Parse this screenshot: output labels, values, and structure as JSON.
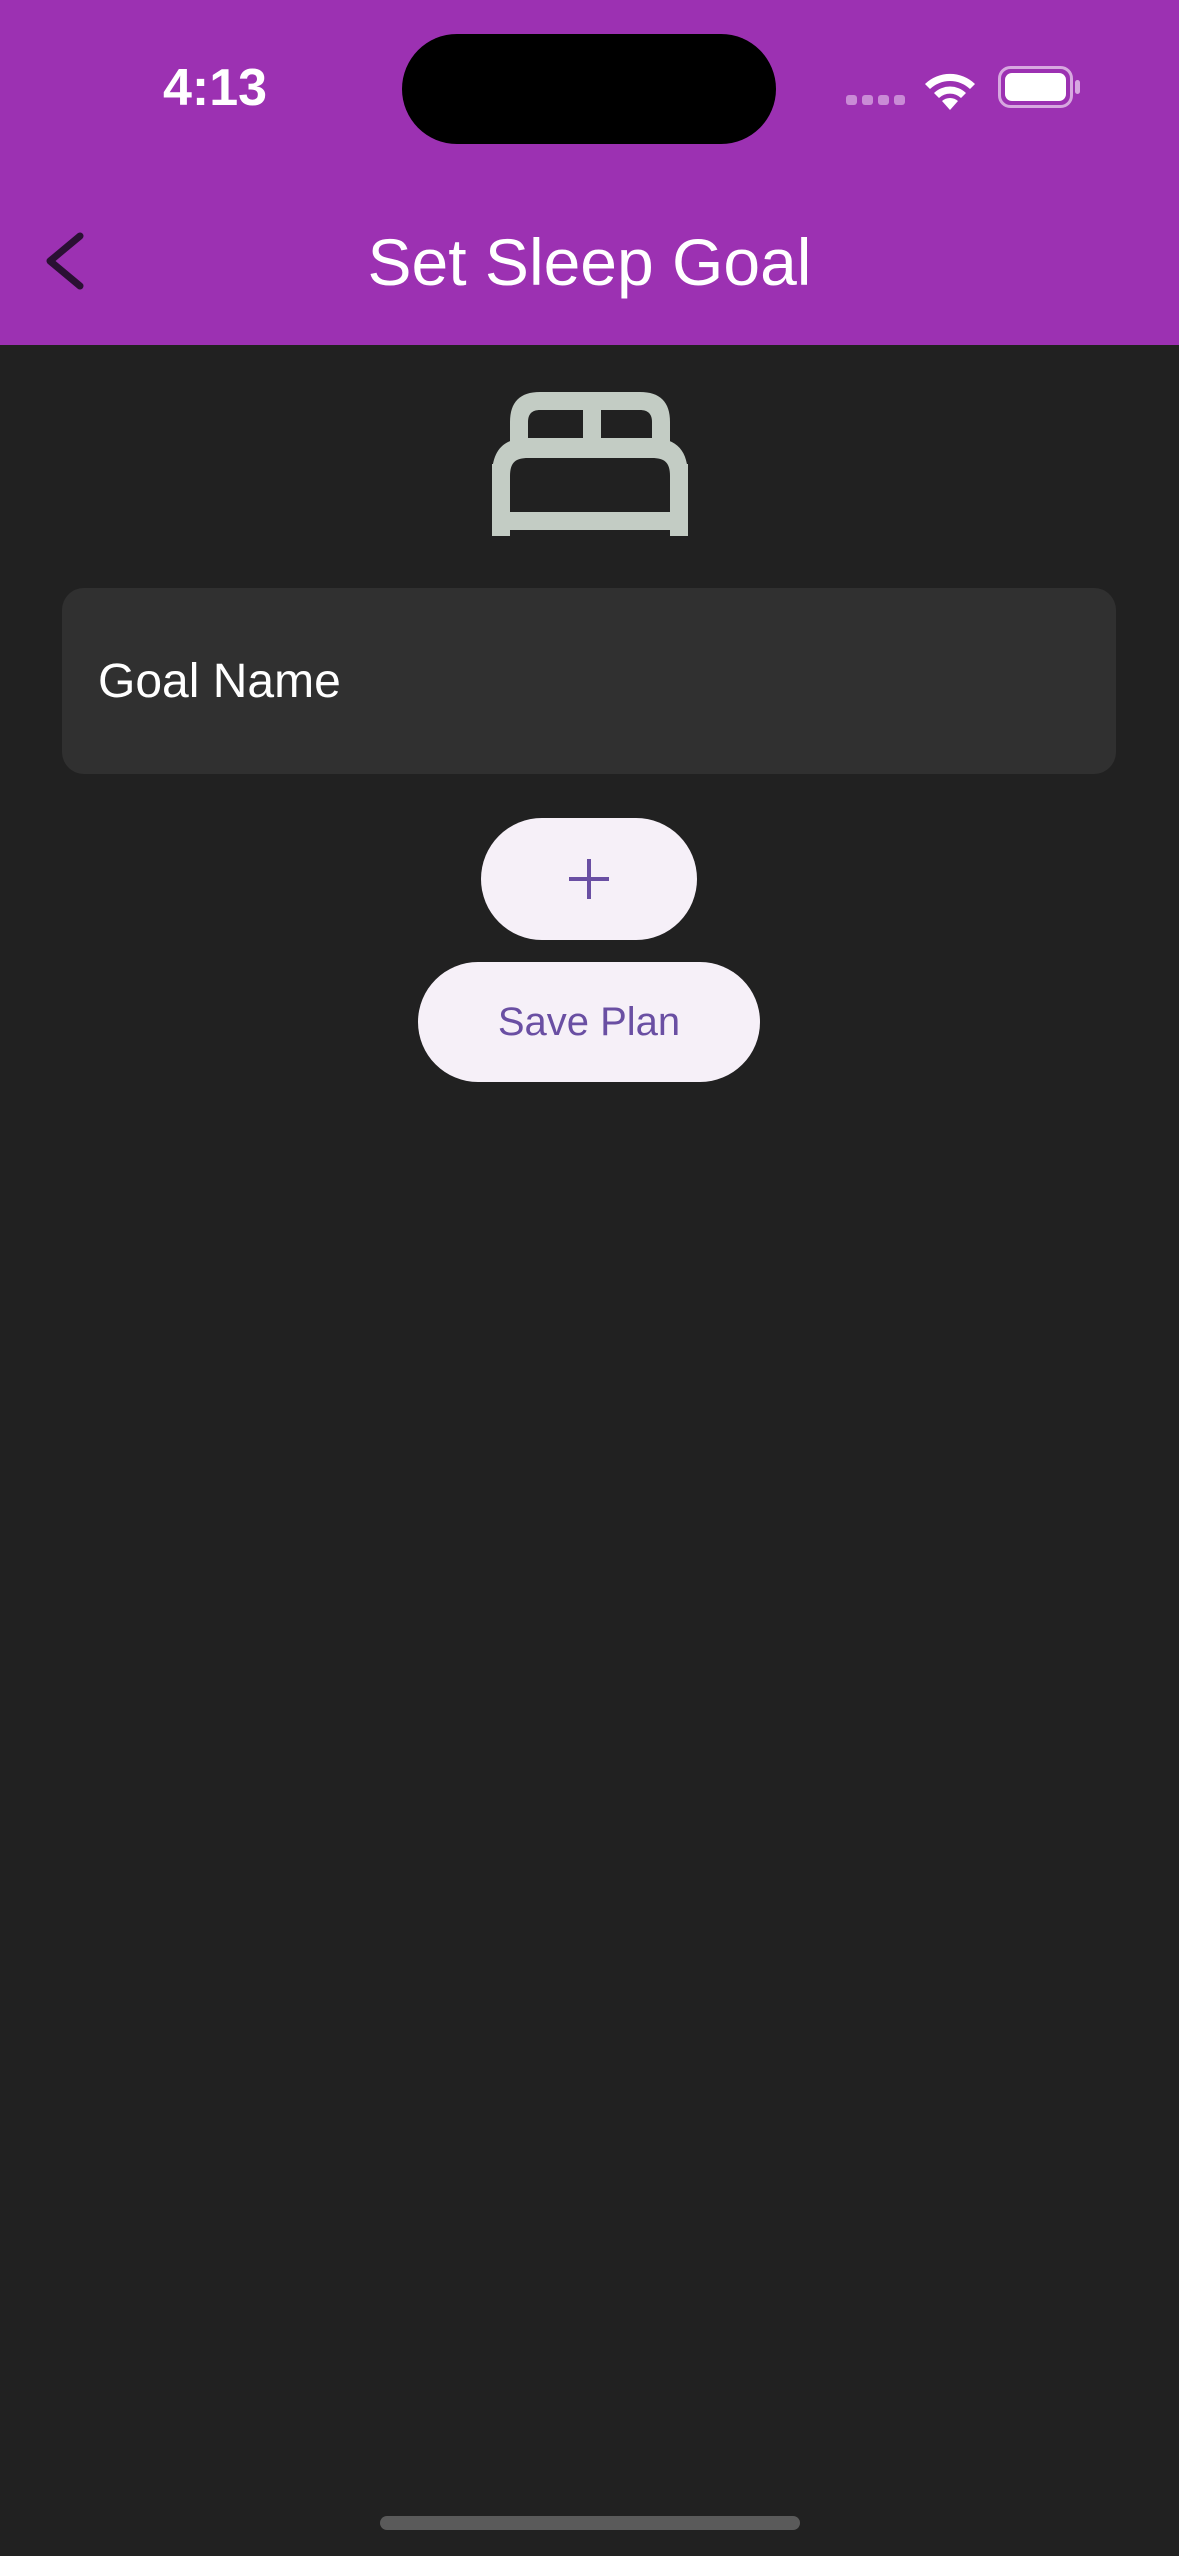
{
  "status_bar": {
    "time": "4:13",
    "signal_icon": "signal-dots-icon",
    "wifi_icon": "wifi-icon",
    "battery_icon": "battery-icon"
  },
  "app_bar": {
    "back_icon": "chevron-left-icon",
    "title": "Set Sleep Goal"
  },
  "content": {
    "hero_icon": "bed-icon",
    "goal_field": {
      "placeholder": "Goal Name",
      "value": ""
    },
    "add_button": {
      "icon": "plus-icon"
    },
    "save_button": {
      "label": "Save Plan"
    }
  },
  "colors": {
    "app_bar": "#9c31b2",
    "background": "#212121",
    "field": "#303030",
    "button_bg": "#f6f0f8",
    "button_text": "#6a4fa3",
    "bed_icon": "#c3ccc4"
  }
}
